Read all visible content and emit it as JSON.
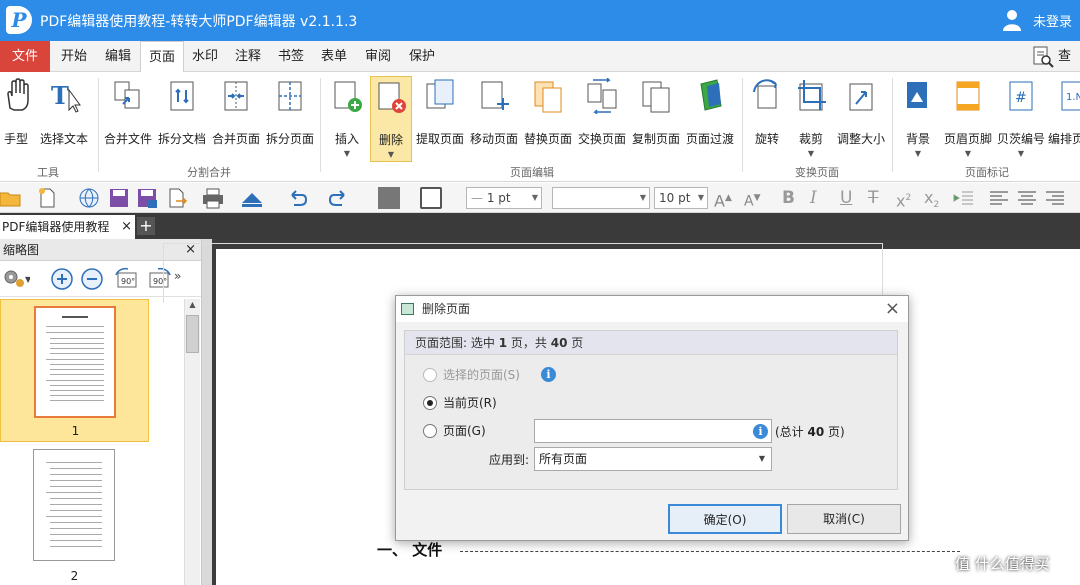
{
  "app": {
    "logo": "P",
    "title": "PDF编辑器使用教程-转转大师PDF编辑器 v2.1.1.3",
    "user": "未登录",
    "user_icon": "user-icon"
  },
  "menu": {
    "file": "文件",
    "items": [
      "开始",
      "编辑",
      "页面",
      "水印",
      "注释",
      "书签",
      "表单",
      "审阅",
      "保护"
    ],
    "active": "页面",
    "find": "查找"
  },
  "ribbon": {
    "groups": [
      {
        "label": "工具",
        "buttons": [
          {
            "label": "手型",
            "icon": "hand-icon"
          },
          {
            "label": "选择文本",
            "icon": "select-text-icon"
          }
        ]
      },
      {
        "label": "分割合并",
        "buttons": [
          {
            "label": "合并文件",
            "icon": "merge-files-icon"
          },
          {
            "label": "拆分文档",
            "icon": "split-doc-icon"
          },
          {
            "label": "合并页面",
            "icon": "merge-pages-icon"
          },
          {
            "label": "拆分页面",
            "icon": "split-pages-icon"
          }
        ]
      },
      {
        "label": "页面编辑",
        "buttons": [
          {
            "label": "插入",
            "icon": "insert-page-icon"
          },
          {
            "label": "删除",
            "icon": "delete-page-icon"
          },
          {
            "label": "提取页面",
            "icon": "extract-page-icon"
          },
          {
            "label": "移动页面",
            "icon": "move-page-icon"
          },
          {
            "label": "替换页面",
            "icon": "replace-page-icon"
          },
          {
            "label": "交换页面",
            "icon": "swap-page-icon"
          },
          {
            "label": "复制页面",
            "icon": "copy-page-icon"
          },
          {
            "label": "页面过渡",
            "icon": "page-transition-icon"
          }
        ]
      },
      {
        "label": "变换页面",
        "buttons": [
          {
            "label": "旋转",
            "icon": "rotate-icon"
          },
          {
            "label": "裁剪",
            "icon": "crop-icon"
          },
          {
            "label": "调整大小",
            "icon": "resize-icon"
          }
        ]
      },
      {
        "label": "页面标记",
        "buttons": [
          {
            "label": "背景",
            "icon": "background-icon"
          },
          {
            "label": "页眉页脚",
            "icon": "header-footer-icon"
          },
          {
            "label": "贝茨编号",
            "icon": "bates-number-icon"
          },
          {
            "label": "编排页",
            "icon": "arrange-page-icon"
          }
        ]
      }
    ]
  },
  "toolbar": {
    "line_width": "1 pt",
    "font_size": "10 pt"
  },
  "doc_tab": {
    "title": "PDF编辑器使用教程",
    "close": "×",
    "add": "+"
  },
  "thumbnails": {
    "header": "缩略图",
    "close": "×",
    "pages": [
      "1",
      "2"
    ]
  },
  "document": {
    "heading": "一、 文件",
    "watermark": "值 什么值得买"
  },
  "dialog": {
    "title": "删除页面",
    "close": "×",
    "range_prefix": "页面范围: 选中",
    "range_selected": "1",
    "range_mid": "页，共",
    "range_total": "40",
    "range_suffix": "页",
    "opt_selected": "选择的页面(S)",
    "opt_current": "当前页(R)",
    "opt_pages": "页面(G)",
    "pages_value": "",
    "total_prefix": "(总计",
    "total_count": "40",
    "total_suffix": "页)",
    "apply_label": "应用到:",
    "apply_value": "所有页面",
    "ok": "确定(O)",
    "cancel": "取消(C)"
  }
}
